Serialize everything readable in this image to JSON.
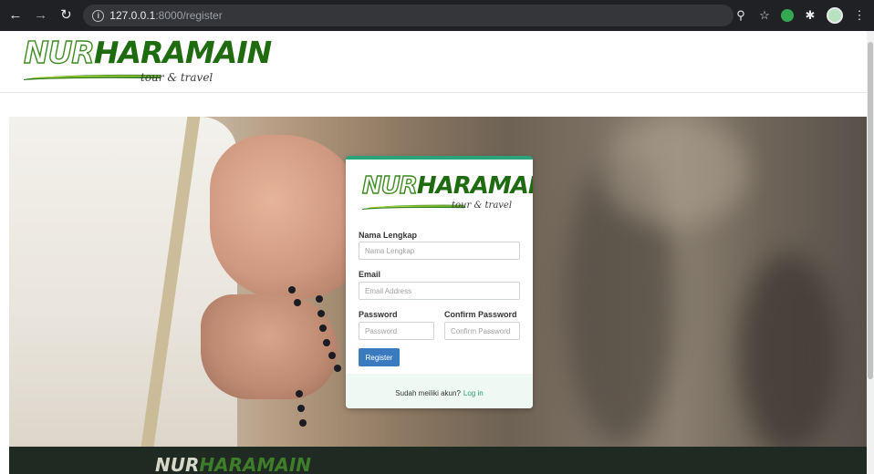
{
  "browser": {
    "url_host": "127.0.0.1",
    "url_path": ":8000/register",
    "icons": [
      "back-icon",
      "forward-icon",
      "reload-icon",
      "info-icon",
      "zoom-icon",
      "star-icon",
      "extension-icon",
      "puzzle-icon",
      "avatar",
      "menu-icon"
    ]
  },
  "header": {
    "logo_nur": "NUR",
    "logo_haramain": "HARAMAIN",
    "logo_tagline": "tour & travel"
  },
  "register_form": {
    "logo_nur": "NUR",
    "logo_haramain": "HARAMAIN",
    "logo_tagline": "tour & travel",
    "fullname_label": "Nama Lengkap",
    "fullname_placeholder": "Nama Lengkap",
    "email_label": "Email",
    "email_placeholder": "Email Address",
    "password_label": "Password",
    "password_placeholder": "Password",
    "confirm_label": "Confirm Password",
    "confirm_placeholder": "Confirm Password",
    "submit_label": "Register",
    "footer_text": "Sudah meiliki akun?",
    "login_link": "Log in"
  },
  "footer": {
    "logo_nur": "NUR",
    "logo_haramain": "HARAMAIN"
  },
  "colors": {
    "accent": "#2aa27a",
    "button": "#3a7bbf",
    "brand_green": "#1f6b10"
  }
}
